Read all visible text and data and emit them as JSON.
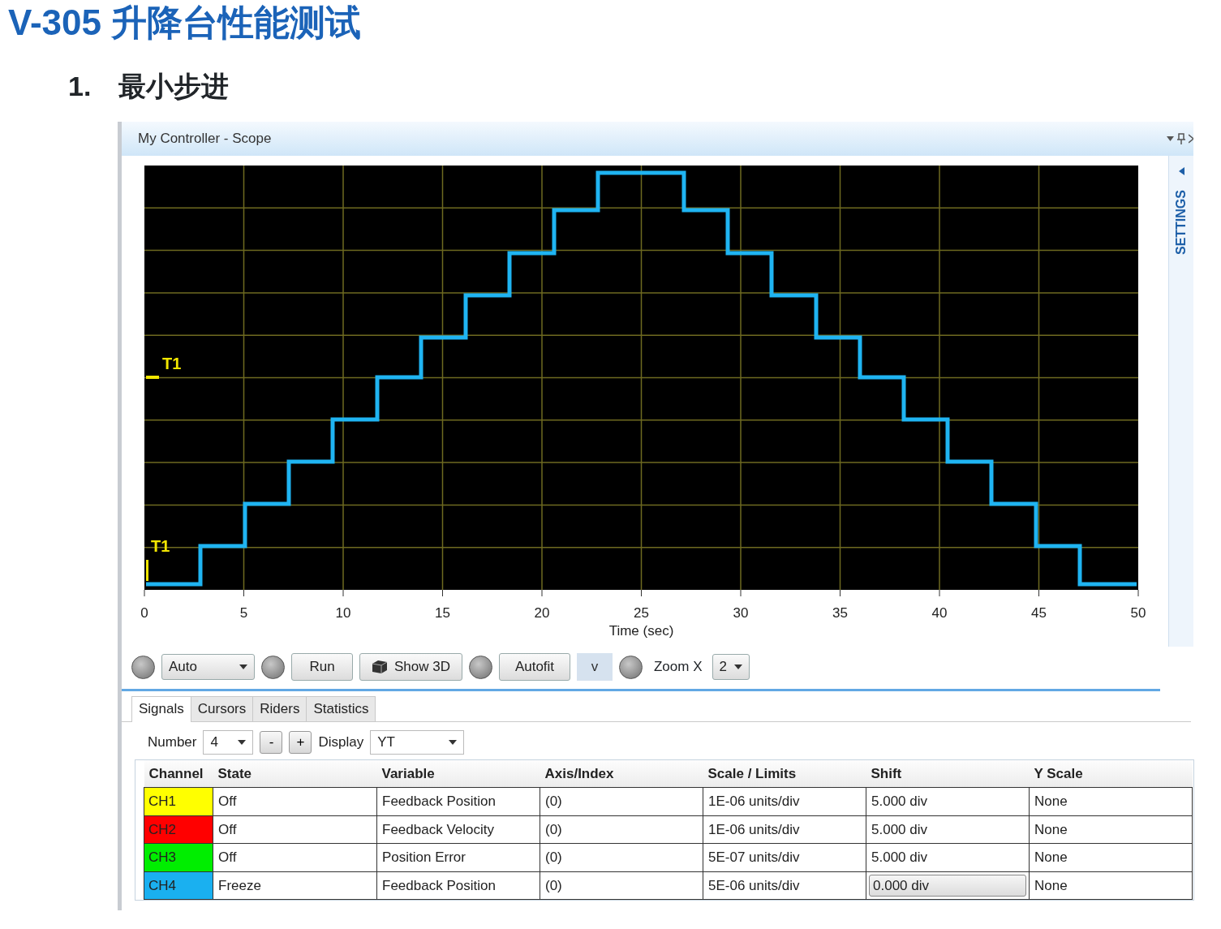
{
  "page": {
    "title": "V-305 升降台性能测试",
    "section_number": "1.",
    "section_title": "最小步进"
  },
  "window": {
    "title": "My Controller - Scope",
    "side_panel": "SETTINGS"
  },
  "scope": {
    "cursors": [
      {
        "label": "T1"
      },
      {
        "label": "T1"
      }
    ],
    "xticks": [
      "0",
      "5",
      "10",
      "15",
      "20",
      "25",
      "30",
      "35",
      "40",
      "45",
      "50"
    ],
    "xlabel": "Time (sec)"
  },
  "toolbar": {
    "trigger_mode": "Auto",
    "run_button": "Run",
    "show3d_button": "Show 3D",
    "autofit_button": "Autofit",
    "v_button": "v",
    "zoom_label": "Zoom X",
    "zoom_value": "2"
  },
  "tabs": [
    {
      "label": "Signals",
      "selected": true
    },
    {
      "label": "Cursors",
      "selected": false
    },
    {
      "label": "Riders",
      "selected": false
    },
    {
      "label": "Statistics",
      "selected": false
    }
  ],
  "signals": {
    "number_label": "Number",
    "number_value": "4",
    "minus_button": "-",
    "plus_button": "+",
    "display_label": "Display",
    "display_value": "YT"
  },
  "table": {
    "columns": [
      "Channel",
      "State",
      "Variable",
      "Axis/Index",
      "Scale / Limits",
      "Shift",
      "Y Scale"
    ],
    "rows": [
      {
        "channel": "CH1",
        "color": "#ffff00",
        "state": "Off",
        "variable": "Feedback Position",
        "axis_index": "(0)",
        "scale": "1E-06 units/div",
        "shift": "5.000 div",
        "shift_editing": false,
        "y_scale": "None"
      },
      {
        "channel": "CH2",
        "color": "#ff0000",
        "state": "Off",
        "variable": "Feedback Velocity",
        "axis_index": "(0)",
        "scale": "1E-06 units/div",
        "shift": "5.000 div",
        "shift_editing": false,
        "y_scale": "None"
      },
      {
        "channel": "CH3",
        "color": "#00ee00",
        "state": "Off",
        "variable": "Position Error",
        "axis_index": "(0)",
        "scale": "5E-07 units/div",
        "shift": "5.000 div",
        "shift_editing": false,
        "y_scale": "None"
      },
      {
        "channel": "CH4",
        "color": "#1ab0f0",
        "state": "Freeze",
        "variable": "Feedback Position",
        "axis_index": "(0)",
        "scale": "5E-06 units/div",
        "shift": "0.000 div",
        "shift_editing": true,
        "y_scale": "None"
      }
    ]
  }
}
